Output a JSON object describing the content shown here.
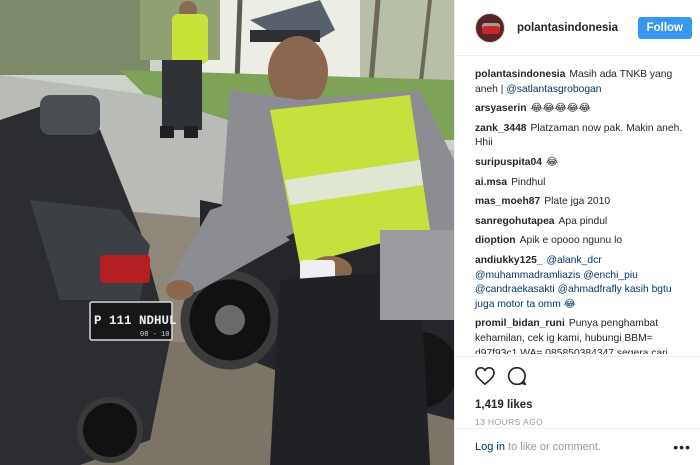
{
  "post": {
    "username": "polantasindonesia",
    "follow_label": "Follow",
    "caption_user": "polantasindonesia",
    "caption_text": "Masih ada TNKB yang aneh | ",
    "caption_mention": "@satlantasgrobogan",
    "plate_text": "P 111 NDHUL",
    "plate_sub": "08 - 10"
  },
  "comments": [
    {
      "user": "arsyaserin",
      "text": "😂😂😂😂😂"
    },
    {
      "user": "zank_3448",
      "text": "Platzaman now pak. Makin aneh. Hhii"
    },
    {
      "user": "suripuspita04",
      "text": "😂"
    },
    {
      "user": "ai.msa",
      "text": "Pindhul"
    },
    {
      "user": "mas_moeh87",
      "text": "Plate jga 2010"
    },
    {
      "user": "sanregohutapea",
      "text": "Apa pindul"
    },
    {
      "user": "dioption",
      "text": "Apik e opooo ngunu lo"
    },
    {
      "user": "andiukky125_",
      "text": "@alank_dcr @muhammadramliazis @enchi_piu @candraekasakti @ahmadfrafly kasih bgtu juga motor ta omm 😂"
    },
    {
      "user": "promil_bidan_runi",
      "text": "Punya penghambat kehamilan, cek ig kami, hubungi BBM= d97f93c1 WA= 085850384347 segera cari"
    }
  ],
  "stats": {
    "likes": "1,419 likes",
    "time": "13 HOURS AGO"
  },
  "footer": {
    "login": "Log in",
    "rest": " to like or comment.",
    "more": "•••"
  },
  "icons": {
    "like": "heart-icon",
    "comment": "comment-icon",
    "more": "more-options-icon"
  },
  "colors": {
    "follow_bg": "#3897f0",
    "link": "#003569",
    "meta": "#999999"
  }
}
